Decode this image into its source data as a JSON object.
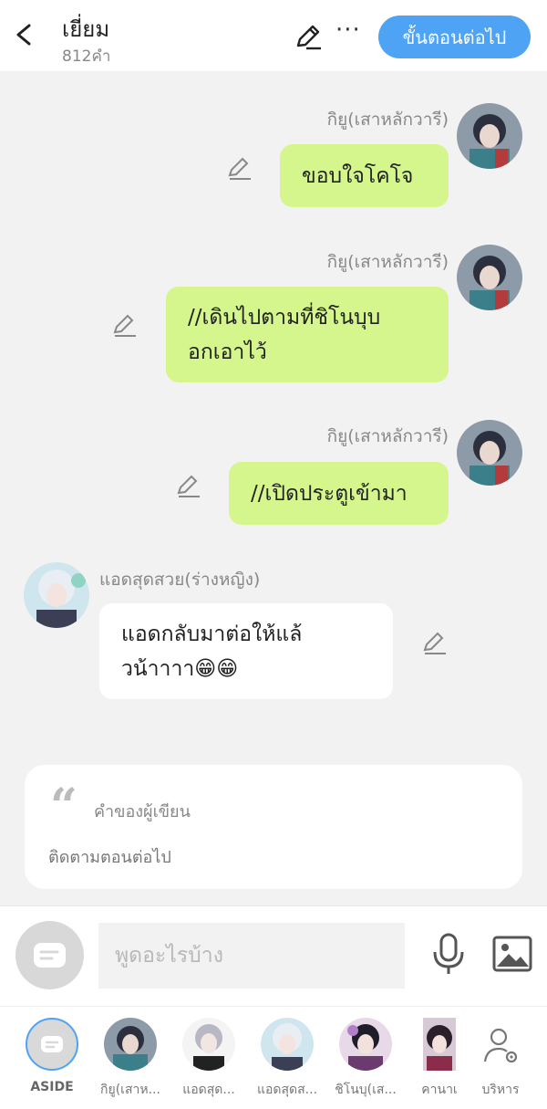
{
  "header": {
    "title": "เยี่ยม",
    "word_count": "812คำ",
    "next_button": "ขั้นตอนต่อไป"
  },
  "messages": [
    {
      "side": "right",
      "name": "กิยู(เสาหลักวารี)",
      "lines": [
        "ขอบใจโคโจ"
      ]
    },
    {
      "side": "right",
      "name": "กิยู(เสาหลักวารี)",
      "lines": [
        "//เดินไปตามที่ชิโนบุบ",
        "อกเอาไว้"
      ]
    },
    {
      "side": "right",
      "name": "กิยู(เสาหลักวารี)",
      "lines": [
        "//เปิดประตูเข้ามา"
      ]
    },
    {
      "side": "left",
      "name": "แอดสุดสวย(ร่างหญิง)",
      "lines": [
        "แอดกลับมาต่อให้แล้",
        "วน้าาาา😁😁"
      ]
    }
  ],
  "author_note": {
    "quote_mark": "“",
    "label": "คำของผู้เขียน",
    "text": "ติดตามตอนต่อไป"
  },
  "input": {
    "placeholder": "พูดอะไรบ้าง"
  },
  "characters": [
    {
      "label": "ASIDE"
    },
    {
      "label": "กิยู(เสาห..."
    },
    {
      "label": "แอดสุด..."
    },
    {
      "label": "แอดสุดส..."
    },
    {
      "label": "ชิโนบุ(เส..."
    },
    {
      "label": "คานาเ"
    },
    {
      "label": "บริหาร"
    }
  ],
  "colors": {
    "accent": "#4fa3f5",
    "bubble_own": "#d5f68c",
    "bubble_other": "#ffffff",
    "background": "#f2f2f2"
  }
}
